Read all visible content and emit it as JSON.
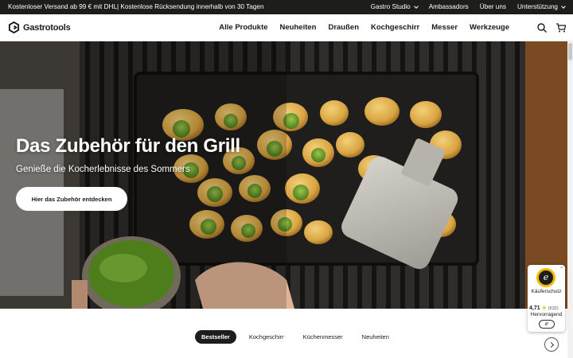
{
  "topbar": {
    "promo": "Kostenloser Versand ab 99 € mit DHL| Kostenlose Rücksendung innerhalb von 30 Tagen",
    "links": [
      "Gastro Studio",
      "Ambassadors",
      "Über uns",
      "Unterstützung"
    ]
  },
  "header": {
    "logo": "Gastrotools",
    "nav": [
      "Alle Produkte",
      "Neuheiten",
      "Draußen",
      "Kochgeschirr",
      "Messer",
      "Werkzeuge"
    ],
    "icons": [
      "search-icon",
      "cart-icon"
    ]
  },
  "hero": {
    "title": "Das Zubehör für den Grill",
    "subtitle": "Genieße die Kocherlebnisse des Sommers",
    "cta": "Hier das Zubehör entdecken"
  },
  "tabs": {
    "items": [
      "Bestseller",
      "Kochgeschirr",
      "Küchenmesser",
      "Neuheiten"
    ],
    "active": "Bestseller"
  },
  "trust": {
    "badge_letter": "e",
    "label": "Käuferschutz",
    "score": "4,71",
    "count": "(632)",
    "grade": "Hervorragend"
  },
  "colors": {
    "dark": "#1d1d1b",
    "accent_yellow": "#f5b800"
  }
}
